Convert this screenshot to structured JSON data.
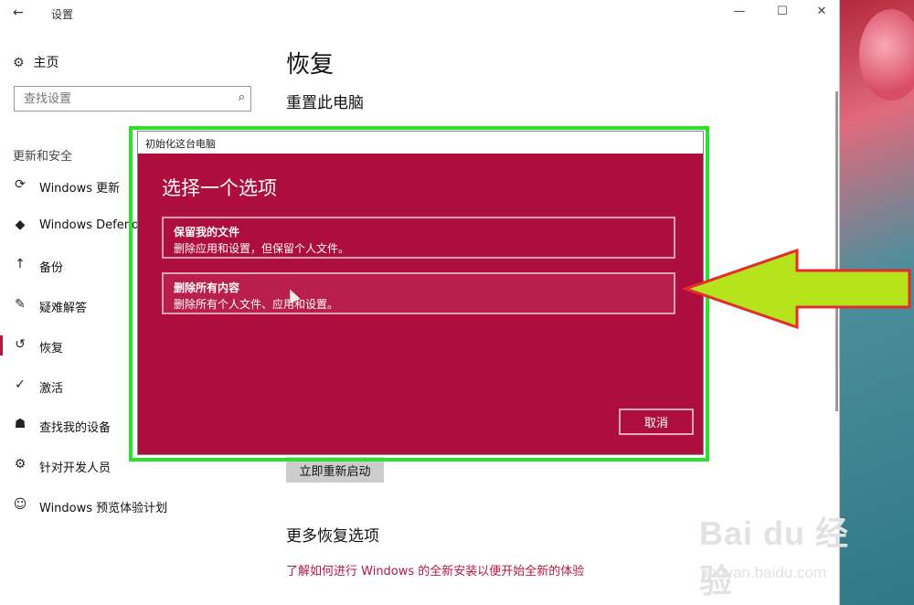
{
  "window": {
    "title": "设置",
    "back_icon": "back-arrow-icon",
    "minimize_glyph": "—",
    "maximize_glyph": "☐",
    "close_glyph": "✕"
  },
  "sidebar": {
    "home_label": "主页",
    "search_placeholder": "查找设置",
    "section_label": "更新和安全",
    "items": [
      {
        "label": "Windows 更新",
        "icon": "sync-icon",
        "glyph": "⟳"
      },
      {
        "label": "Windows Defender",
        "icon": "shield-icon",
        "glyph": "◆"
      },
      {
        "label": "备份",
        "icon": "backup-arrow-icon",
        "glyph": "↑"
      },
      {
        "label": "疑难解答",
        "icon": "wrench-icon",
        "glyph": "✎"
      },
      {
        "label": "恢复",
        "icon": "history-icon",
        "glyph": "↺"
      },
      {
        "label": "激活",
        "icon": "check-circle-icon",
        "glyph": "✓"
      },
      {
        "label": "查找我的设备",
        "icon": "person-locate-icon",
        "glyph": "☗"
      },
      {
        "label": "针对开发人员",
        "icon": "developer-sliders-icon",
        "glyph": "⚙"
      },
      {
        "label": "Windows 预览体验计划",
        "icon": "insider-cat-icon",
        "glyph": "☺"
      }
    ]
  },
  "main": {
    "page_title": "恢复",
    "section_title": "重置此电脑",
    "restart_button": "立即重新启动",
    "more_title": "更多恢复选项",
    "link_text": "了解如何进行 Windows 的全新安装以便开始全新的体验"
  },
  "dialog": {
    "window_title": "初始化这台电脑",
    "heading": "选择一个选项",
    "options": [
      {
        "title": "保留我的文件",
        "desc": "删除应用和设置，但保留个人文件。"
      },
      {
        "title": "删除所有内容",
        "desc": "删除所有个人文件、应用和设置。"
      }
    ],
    "cancel_label": "取消"
  },
  "colors": {
    "dialog_bg": "#ad0d3f",
    "accent": "#b3183f",
    "highlight_box": "#2ee02e",
    "arrow_fill": "#b5e31c",
    "arrow_outline": "#e52b2b"
  },
  "watermark": {
    "brand": "Bai du 经验",
    "site": "jingyan.baidu.com"
  }
}
